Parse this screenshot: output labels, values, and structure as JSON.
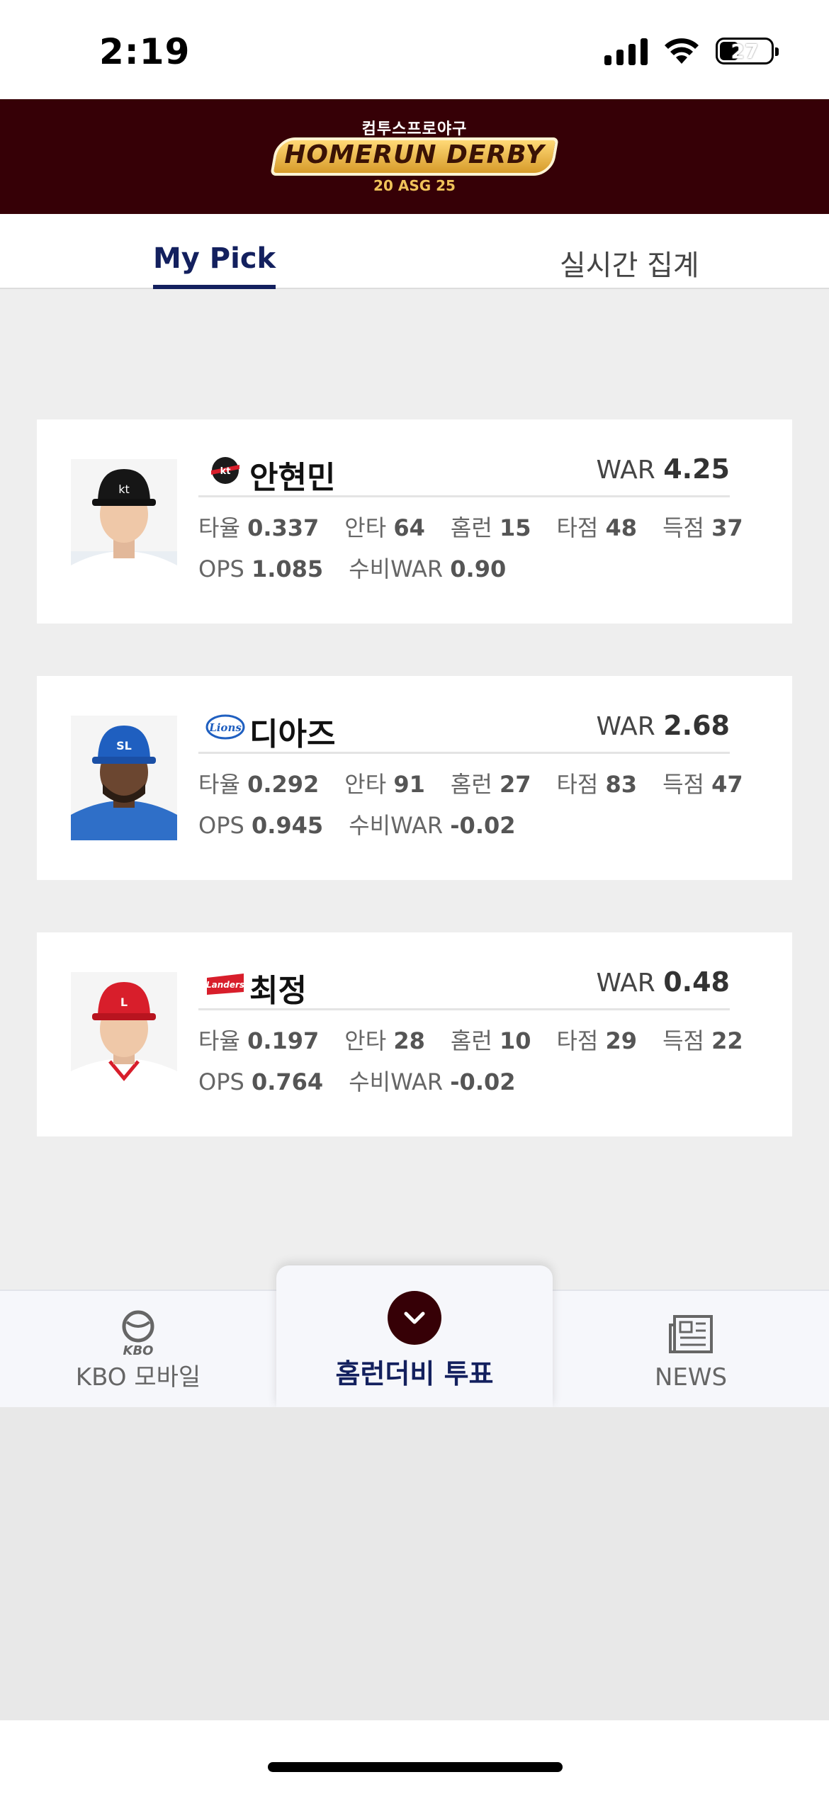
{
  "status_bar": {
    "time": "2:19",
    "battery": "27"
  },
  "header": {
    "logo_top": "컴투스프로야구",
    "logo_main": "HOMERUN DERBY",
    "logo_sub": "20 ASG 25",
    "colors": {
      "background": "#360006",
      "logo_gold": "#f0c35a"
    }
  },
  "tabs": [
    {
      "label": "My Pick",
      "active": true
    },
    {
      "label": "실시간 집계",
      "active": false
    }
  ],
  "players": [
    {
      "name": "안현민",
      "team_logo": "kt-wiz-logo",
      "war_label": "WAR",
      "war": "4.25",
      "stats_line1": [
        {
          "label": "타율",
          "value": "0.337"
        },
        {
          "label": "안타",
          "value": "64"
        },
        {
          "label": "홈런",
          "value": "15"
        },
        {
          "label": "타점",
          "value": "48"
        },
        {
          "label": "득점",
          "value": "37"
        }
      ],
      "stats_line2": [
        {
          "label": "OPS",
          "value": "1.085"
        },
        {
          "label": "수비WAR",
          "value": "0.90"
        }
      ]
    },
    {
      "name": "디아즈",
      "team_logo": "samsung-lions-logo",
      "war_label": "WAR",
      "war": "2.68",
      "stats_line1": [
        {
          "label": "타율",
          "value": "0.292"
        },
        {
          "label": "안타",
          "value": "91"
        },
        {
          "label": "홈런",
          "value": "27"
        },
        {
          "label": "타점",
          "value": "83"
        },
        {
          "label": "득점",
          "value": "47"
        }
      ],
      "stats_line2": [
        {
          "label": "OPS",
          "value": "0.945"
        },
        {
          "label": "수비WAR",
          "value": "-0.02"
        }
      ]
    },
    {
      "name": "최정",
      "team_logo": "ssg-landers-logo",
      "war_label": "WAR",
      "war": "0.48",
      "stats_line1": [
        {
          "label": "타율",
          "value": "0.197"
        },
        {
          "label": "안타",
          "value": "28"
        },
        {
          "label": "홈런",
          "value": "10"
        },
        {
          "label": "타점",
          "value": "29"
        },
        {
          "label": "득점",
          "value": "22"
        }
      ],
      "stats_line2": [
        {
          "label": "OPS",
          "value": "0.764"
        },
        {
          "label": "수비WAR",
          "value": "-0.02"
        }
      ]
    }
  ],
  "bottom_nav": {
    "left": {
      "icon": "kbo-logo-icon",
      "icon_text": "KBO",
      "label": "KBO 모바일"
    },
    "center": {
      "icon": "chevron-down-icon",
      "label": "홈런더비 투표"
    },
    "right": {
      "icon": "newspaper-icon",
      "label": "NEWS"
    }
  }
}
